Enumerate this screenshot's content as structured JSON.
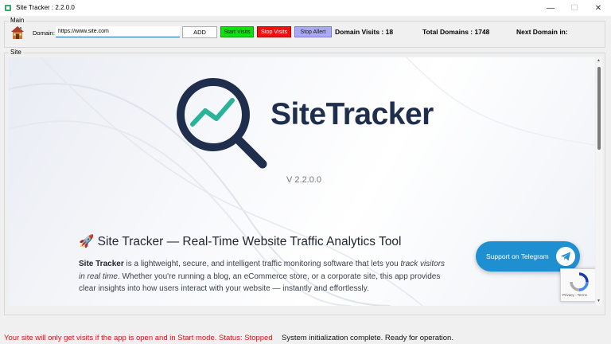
{
  "window": {
    "title": "Site Tracker : 2.2.0.0",
    "min_glyph": "—",
    "max_glyph": "☐",
    "close_glyph": "✕"
  },
  "main_group": {
    "label": "Main",
    "domain_label": "Domain:",
    "domain_value": "https://www.site.com",
    "add_label": "ADD",
    "start_label": "Start Visits",
    "stop_label": "Stop Visits",
    "alert_label": "Stop Allert",
    "domain_visits": "Domain Visits : 18",
    "total_domains": "Total Domains : 1748",
    "next_domain": "Next Domain in:"
  },
  "site_group": {
    "label": "Site"
  },
  "webview": {
    "logo_text": "SiteTracker",
    "version": "V 2.2.0.0",
    "heading": "🚀 Site Tracker — Real-Time Website Traffic Analytics Tool",
    "para_bold": "Site Tracker",
    "para_1": " is a lightweight, secure, and intelligent traffic monitoring software that lets you",
    "para_italic": "track visitors in real time",
    "para_2": ". Whether you're running a blog, an eCommerce store, or a corporate site, this app provides clear insights into how users interact with your website — instantly and effortlessly.",
    "telegram_label": "Support on Telegram",
    "recaptcha_legal": "Privacy - Terms"
  },
  "status": {
    "warning": "Your site will only get visits if the app is open and in Start mode. Status: Stopped",
    "message": "System initialization complete. Ready for operation."
  },
  "colors": {
    "logo_navy": "#1f2e4d",
    "logo_teal": "#2bb39a",
    "start_green": "#10e010",
    "stop_red": "#ef1010",
    "alert_lavender": "#aaaaf2",
    "telegram_blue": "#1e8fd0",
    "warning_red": "#e01010"
  },
  "icons": {
    "app": "site-tracker-app-icon",
    "home": "house-icon",
    "telegram": "paper-plane-icon",
    "recaptcha": "recaptcha-icon"
  }
}
